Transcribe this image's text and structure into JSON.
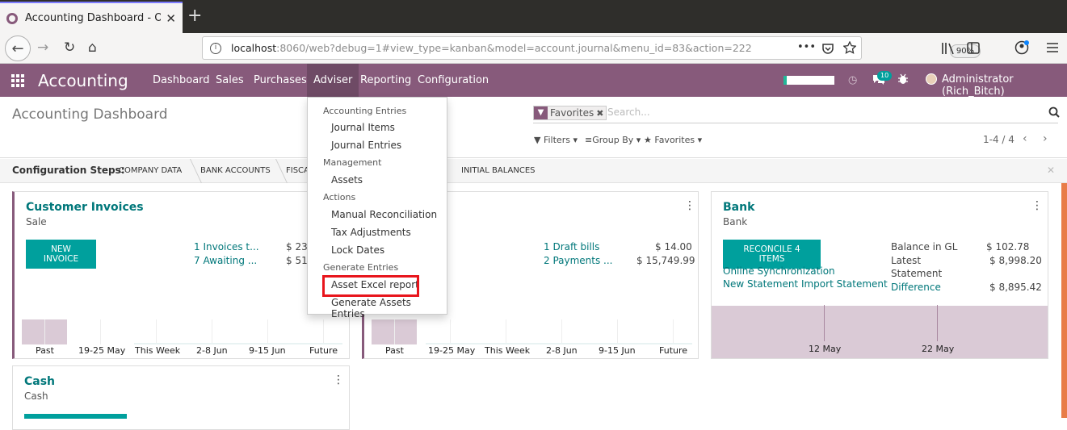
{
  "browser": {
    "tab_title": "Accounting Dashboard - Od",
    "tab_close": "✕",
    "new_tab": "+",
    "back": "←",
    "forward": "→",
    "reload": "↻",
    "home": "⌂",
    "url_host": "localhost",
    "url_rest": ":8060/web?debug=1#view_type=kanban&model=account.journal&menu_id=83&action=222",
    "zoom": "90%",
    "page_actions": "•••",
    "icons": [
      "library-icon",
      "sidebar-icon",
      "account-icon",
      "hamburger-icon"
    ]
  },
  "app": {
    "brand": "Accounting",
    "menus": [
      "Dashboard",
      "Sales",
      "Purchases",
      "Adviser",
      "Reporting",
      "Configuration"
    ],
    "active_menu": "Adviser",
    "chat_badge": "10",
    "user": "Administrator (Rich_Bitch)",
    "accent": "#875a7b",
    "button_color": "#00a09d"
  },
  "control_panel": {
    "title": "Accounting Dashboard",
    "facet": "Favorites",
    "search_placeholder": "Search...",
    "filters": "Filters",
    "group_by": "Group By",
    "favorites": "Favorites",
    "pager": "1-4 / 4"
  },
  "steps": {
    "label": "Configuration Steps:",
    "items": [
      "COMPANY DATA",
      "BANK ACCOUNTS",
      "FISCA",
      "INITIAL BALANCES"
    ]
  },
  "dropdown": {
    "h1": "Accounting Entries",
    "i1": "Journal Items",
    "i2": "Journal Entries",
    "h2": "Management",
    "i3": "Assets",
    "h3": "Actions",
    "i4": "Manual Reconciliation",
    "i5": "Tax Adjustments",
    "i6": "Lock Dates",
    "h4": "Generate Entries",
    "i7": "Asset Excel report",
    "i8": "Generate Assets Entries"
  },
  "cards": {
    "customer": {
      "title": "Customer Invoices",
      "sub": "Sale",
      "button": "NEW INVOICE",
      "link1": "1 Invoices t...",
      "amt1": "$ 23,",
      "link2": "7 Awaiting ...",
      "amt2": "$ 51,"
    },
    "vendor": {
      "link1": "1 Draft bills",
      "amt1": "$ 14.00",
      "link2": "2 Payments ...",
      "amt2": "$ 15,749.99"
    },
    "bank": {
      "title": "Bank",
      "sub": "Bank",
      "button": "RECONCILE 4 ITEMS",
      "link1": "Online Synchronization",
      "link2": "New Statement Import Statement",
      "bal_label": "Balance in GL",
      "bal_amt": "$ 102.78",
      "latest_label1": "Latest",
      "latest_label2": "Statement",
      "latest_amt": "$ 8,998.20",
      "diff_label": "Difference",
      "diff_amt": "$ 8,895.42",
      "x_labels": [
        "12 May",
        "22 May"
      ]
    },
    "cash": {
      "title": "Cash",
      "sub": "Cash"
    },
    "x_labels": [
      "Past",
      "19-25 May",
      "This Week",
      "2-8 Jun",
      "9-15 Jun",
      "Future"
    ]
  }
}
